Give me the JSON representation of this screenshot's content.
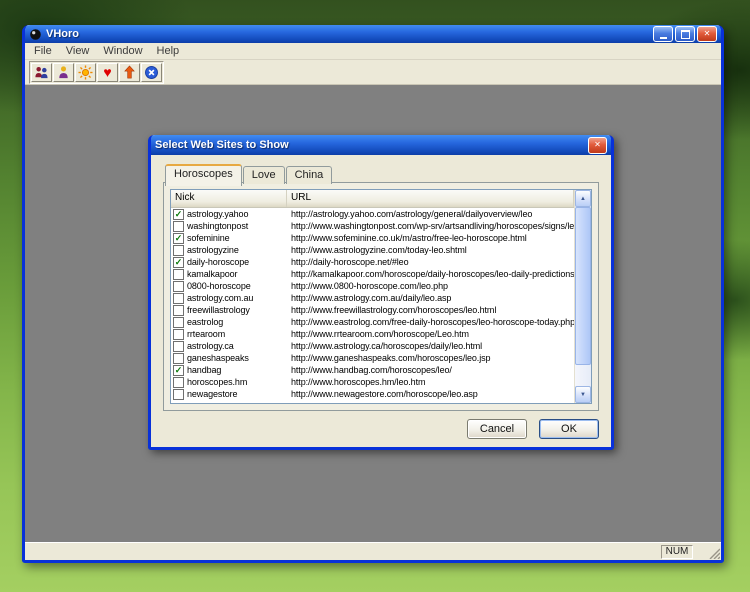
{
  "colors": {
    "titlebar_blue": "#2667DE",
    "window_border_blue": "#0831D9",
    "client_gray": "#808080",
    "dialog_bg": "#ECE9D8",
    "check_green": "#0B7A0B",
    "close_button_red": "#E25C3C",
    "heart_red": "#E00000"
  },
  "window": {
    "title": "VHoro",
    "menu": [
      "File",
      "View",
      "Window",
      "Help"
    ],
    "toolbar_icons": [
      "contacts-icon",
      "person-icon",
      "sun-icon",
      "heart-icon",
      "up-arrow-icon",
      "exit-icon"
    ],
    "statusbar": {
      "num": "NUM"
    }
  },
  "dialog": {
    "title": "Select Web Sites to Show",
    "tabs": [
      "Horoscopes",
      "Love",
      "China"
    ],
    "columns": [
      "Nick",
      "URL"
    ],
    "buttons": {
      "cancel": "Cancel",
      "ok": "OK"
    },
    "rows": [
      {
        "checked": true,
        "nick": "astrology.yahoo",
        "url": "http://astrology.yahoo.com/astrology/general/dailyoverview/leo"
      },
      {
        "checked": false,
        "nick": "washingtonpost",
        "url": "http://www.washingtonpost.com/wp-srv/artsandliving/horoscopes/signs/leo.html"
      },
      {
        "checked": true,
        "nick": "sofeminine",
        "url": "http://www.sofeminine.co.uk/m/astro/free-leo-horoscope.html"
      },
      {
        "checked": false,
        "nick": "astrologyzine",
        "url": "http://www.astrologyzine.com/today-leo.shtml"
      },
      {
        "checked": true,
        "nick": "daily-horoscope",
        "url": "http://daily-horoscope.net/#leo"
      },
      {
        "checked": false,
        "nick": "kamalkapoor",
        "url": "http://kamalkapoor.com/horoscope/daily-horoscopes/leo-daily-predictions.asp"
      },
      {
        "checked": false,
        "nick": "0800-horoscope",
        "url": "http://www.0800-horoscope.com/leo.php"
      },
      {
        "checked": false,
        "nick": "astrology.com.au",
        "url": "http://www.astrology.com.au/daily/leo.asp"
      },
      {
        "checked": false,
        "nick": "freewillastrology",
        "url": "http://www.freewillastrology.com/horoscopes/leo.html"
      },
      {
        "checked": false,
        "nick": "eastrolog",
        "url": "http://www.eastrolog.com/free-daily-horoscopes/leo-horoscope-today.php"
      },
      {
        "checked": false,
        "nick": "rrtearoom",
        "url": "http://www.rrtearoom.com/horoscope/Leo.htm"
      },
      {
        "checked": false,
        "nick": "astrology.ca",
        "url": "http://www.astrology.ca/horoscopes/daily/leo.html"
      },
      {
        "checked": false,
        "nick": "ganeshaspeaks",
        "url": "http://www.ganeshaspeaks.com/horoscopes/leo.jsp"
      },
      {
        "checked": true,
        "nick": "handbag",
        "url": "http://www.handbag.com/horoscopes/leo/"
      },
      {
        "checked": false,
        "nick": "horoscopes.hm",
        "url": "http://www.horoscopes.hm/leo.htm"
      },
      {
        "checked": false,
        "nick": "newagestore",
        "url": "http://www.newagestore.com/horoscope/leo.asp"
      }
    ]
  }
}
